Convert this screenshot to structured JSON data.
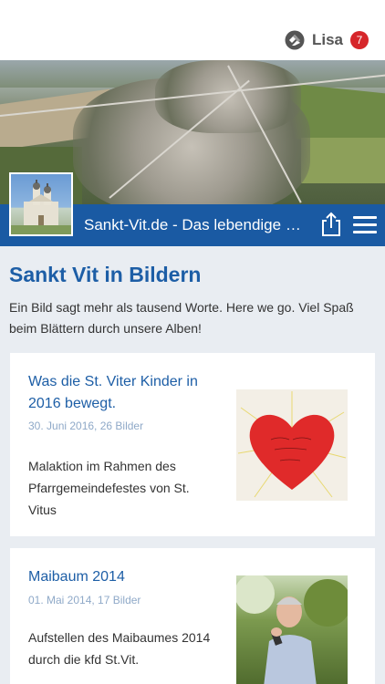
{
  "user": {
    "name": "Lisa",
    "badge_count": "7",
    "logo_icon": "app-logo-icon"
  },
  "header": {
    "site_title": "Sankt-Vit.de - Das lebendige Dorf",
    "share_icon": "share-icon",
    "menu_icon": "hamburger-menu-icon"
  },
  "page": {
    "title": "Sankt Vit in Bildern",
    "intro": "Ein Bild sagt mehr als tausend Worte. Here we go. Viel Spaß beim Blättern durch unsere Alben!"
  },
  "albums": [
    {
      "title": "Was die St. Viter Kinder in 2016 bewegt.",
      "meta": "30. Juni 2016, 26 Bilder",
      "description": "Malaktion im Rahmen des Pfarrgemeindefestes von St. Vitus"
    },
    {
      "title": "Maibaum 2014",
      "meta": "01. Mai 2014, 17 Bilder",
      "description": "Aufstellen des Maibaumes 2014 durch die kfd St.Vit."
    }
  ],
  "colors": {
    "brand_blue": "#1a5aa3",
    "title_blue": "#1d5ea6",
    "badge_red": "#d6262a",
    "meta_blue": "#8fa9c8"
  }
}
